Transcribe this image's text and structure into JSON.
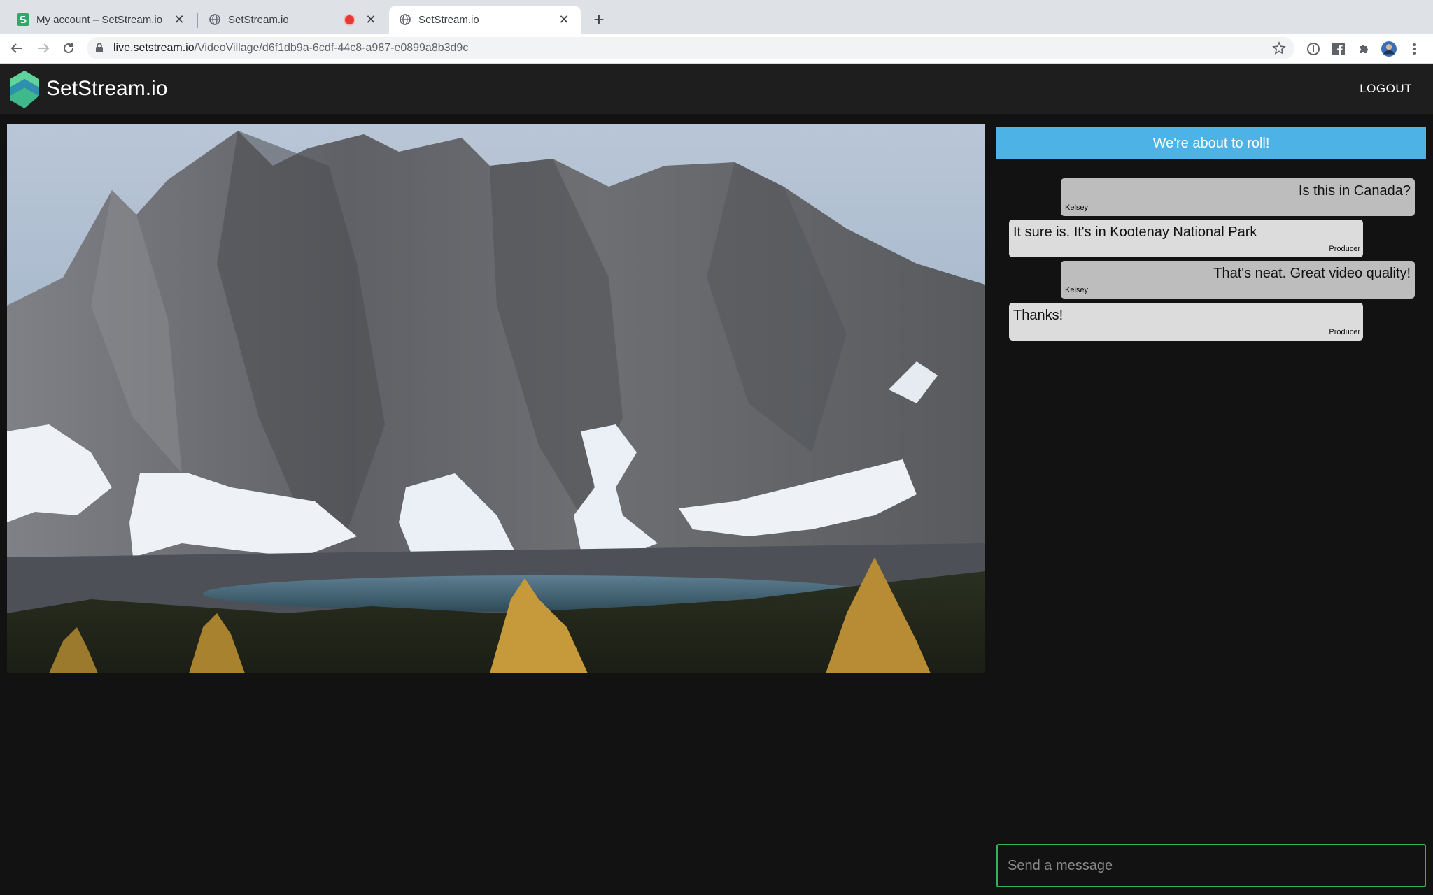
{
  "browser": {
    "tabs": [
      {
        "title": "My account – SetStream.io",
        "favicon": "setstream-favicon",
        "active": false
      },
      {
        "title": "SetStream.io",
        "favicon": "globe-icon",
        "recording": true,
        "active": false
      },
      {
        "title": "SetStream.io",
        "favicon": "globe-icon",
        "active": true
      }
    ],
    "url_host": "live.setstream.io",
    "url_path": "/VideoVillage/d6f1db9a-6cdf-44c8-a987-e0899a8b3d9c"
  },
  "app": {
    "brand": "SetStream.io",
    "logout_label": "LOGOUT",
    "accent_color": "#4db3e6",
    "input_border_color": "#2fb35f"
  },
  "chat": {
    "banner": "We're about to roll!",
    "messages": [
      {
        "text": "Is this in Canada?",
        "sender": "Kelsey",
        "align": "right"
      },
      {
        "text": "It sure is. It's in Kootenay National Park",
        "sender": "Producer",
        "align": "left"
      },
      {
        "text": "That's neat. Great video quality!",
        "sender": "Kelsey",
        "align": "right"
      },
      {
        "text": "Thanks!",
        "sender": "Producer",
        "align": "left"
      }
    ],
    "input_placeholder": "Send a message"
  }
}
